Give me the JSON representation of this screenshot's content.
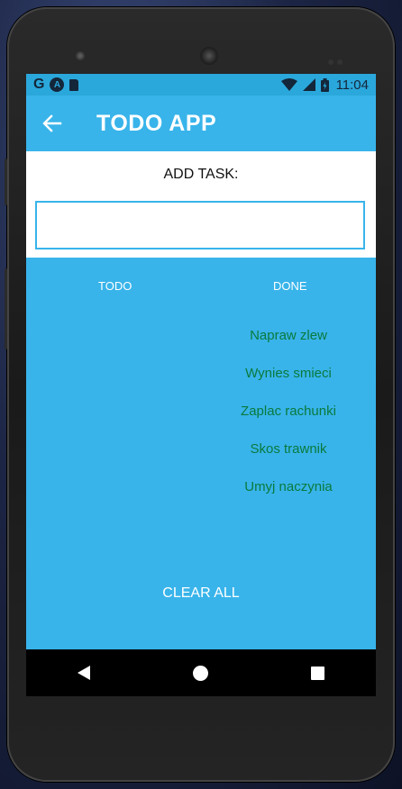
{
  "status_bar": {
    "left_icons": [
      "google-g-icon",
      "android-a-icon",
      "sd-card-icon"
    ],
    "google_letter": "G",
    "a_letter": "A",
    "right_icons": [
      "wifi-icon",
      "signal-icon",
      "battery-icon"
    ],
    "time": "11:04"
  },
  "app_bar": {
    "back_icon": "arrow-left-icon",
    "title": "TODO APP"
  },
  "add_task": {
    "label": "ADD TASK:",
    "input_value": "",
    "placeholder": ""
  },
  "columns": {
    "todo_header": "TODO",
    "done_header": "DONE",
    "todo_items": [],
    "done_items": [
      "Napraw zlew",
      "Wynies smieci",
      "Zaplac rachunki",
      "Skos trawnik",
      "Umyj naczynia"
    ]
  },
  "clear_all_label": "CLEAR ALL",
  "colors": {
    "primary": "#38b4ea",
    "done_text": "#0a7a3d",
    "navbar": "#000000"
  }
}
